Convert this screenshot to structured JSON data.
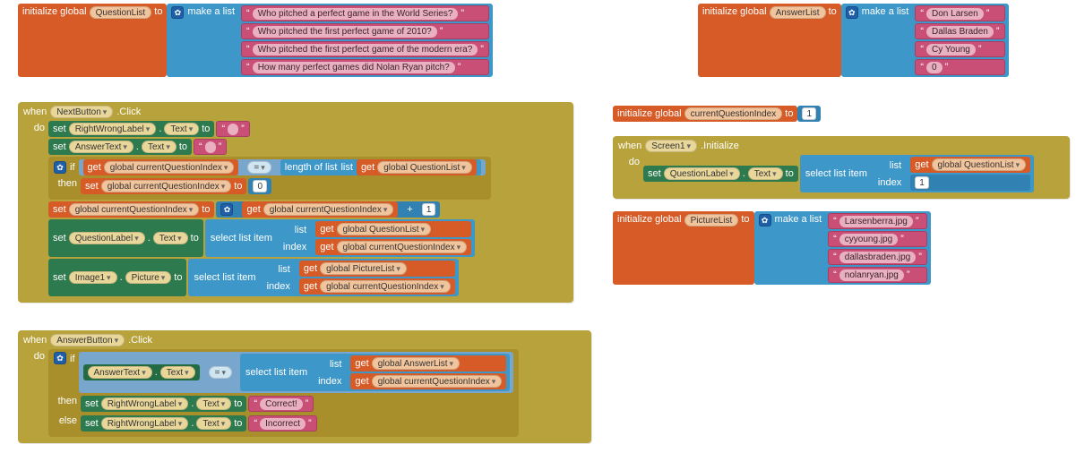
{
  "kw": {
    "init_global": "initialize global",
    "to": "to",
    "make_list": "make a list",
    "when": "when",
    "click": ".Click",
    "initialize": ".Initialize",
    "do": "do",
    "set": "set",
    "get": "get",
    "if": "if",
    "then": "then",
    "else": "else",
    "length_of_list": "length of list",
    "list_sfx": "list",
    "select_list_item": "select list item",
    "index": "index",
    "text_prop": "Text",
    "picture_prop": "Picture",
    "dot": ".",
    "eq": "=",
    "plus": "+"
  },
  "vars": {
    "QuestionList": "QuestionList",
    "AnswerList": "AnswerList",
    "PictureList": "PictureList",
    "currentQuestionIndex": "currentQuestionIndex",
    "g_currentQuestionIndex": "global currentQuestionIndex",
    "g_QuestionList": "global QuestionList",
    "g_AnswerList": "global AnswerList",
    "g_PictureList": "global PictureList"
  },
  "components": {
    "NextButton": "NextButton",
    "AnswerButton": "AnswerButton",
    "Screen1": "Screen1",
    "RightWrongLabel": "RightWrongLabel",
    "AnswerText": "AnswerText",
    "QuestionLabel": "QuestionLabel",
    "Image1": "Image1"
  },
  "lists": {
    "questions": [
      "Who pitched a perfect game in the World Series?",
      "Who pitched the first perfect game of 2010?",
      "Who pitched the first perfect game of the modern era?",
      "How many perfect games did Nolan Ryan pitch?"
    ],
    "answers": [
      "Don Larsen",
      "Dallas Braden",
      "Cy Young",
      "0"
    ],
    "pictures": [
      "Larsenberra.jpg",
      "cyyoung.jpg",
      "dallasbraden.jpg",
      "nolanryan.jpg"
    ]
  },
  "values": {
    "empty": "",
    "zero": "0",
    "one": "1",
    "correct": "Correct!",
    "incorrect": "Incorrect"
  }
}
